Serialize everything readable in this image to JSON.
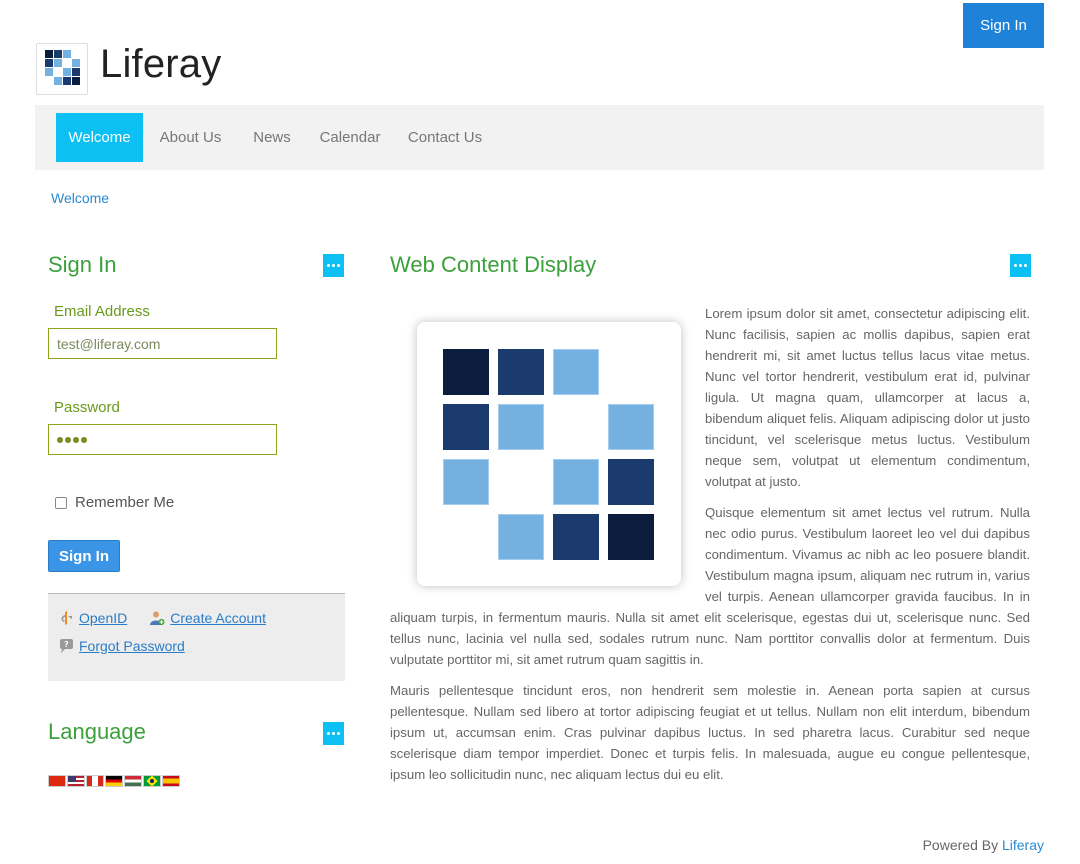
{
  "header": {
    "sign_in_label": "Sign In",
    "site_title": "Liferay"
  },
  "nav": {
    "items": [
      {
        "label": "Welcome",
        "active": true
      },
      {
        "label": "About Us",
        "active": false
      },
      {
        "label": "News",
        "active": false
      },
      {
        "label": "Calendar",
        "active": false
      },
      {
        "label": "Contact Us",
        "active": false
      }
    ]
  },
  "breadcrumb": "Welcome",
  "sign_in_portlet": {
    "title": "Sign In",
    "email_label": "Email Address",
    "email_value": "test@liferay.com",
    "password_label": "Password",
    "password_length": 4,
    "remember_label": "Remember Me",
    "submit_label": "Sign In",
    "links": {
      "openid": "OpenID",
      "create_account": "Create Account",
      "forgot_password": "Forgot Password"
    }
  },
  "language_portlet": {
    "title": "Language",
    "flags": [
      "zh-CN",
      "en-US",
      "en-CA",
      "de-DE",
      "hu-HU",
      "pt-BR",
      "es-ES"
    ]
  },
  "web_content": {
    "title": "Web Content Display",
    "paragraph_1": "Lorem ipsum dolor sit amet, consectetur adipiscing elit. Nunc facilisis, sapien ac mollis dapibus, sapien erat hendrerit mi, sit amet luctus tellus lacus vitae metus. Nunc vel tortor hendrerit, vestibulum erat id, pulvinar ligula. Ut magna quam, ullamcorper at lacus a, bibendum aliquet felis. Aliquam adipiscing dolor ut justo tincidunt, vel scelerisque metus luctus. Vestibulum neque sem, volutpat ut elementum condimentum, volutpat at justo.",
    "paragraph_2": "Quisque elementum sit amet lectus vel rutrum. Nulla nec odio purus. Vestibulum laoreet leo vel dui dapibus condimentum. Vivamus ac nibh ac leo posuere blandit. Vestibulum magna ipsum, aliquam nec rutrum in, varius vel turpis. Aenean ullamcorper gravida faucibus. In in aliquam turpis, in fermentum mauris. Nulla sit amet elit scelerisque, egestas dui ut, scelerisque nunc. Sed tellus nunc, lacinia vel nulla sed, sodales rutrum nunc. Nam porttitor convallis dolor at fermentum. Duis vulputate porttitor mi, sit amet rutrum quam sagittis in.",
    "paragraph_3": "Mauris pellentesque tincidunt eros, non hendrerit sem molestie in. Aenean porta sapien at cursus pellentesque. Nullam sed libero at tortor adipiscing feugiat et ut tellus. Nullam non elit interdum, bibendum ipsum ut, accumsan enim. Cras pulvinar dapibus luctus. In sed pharetra lacus. Curabitur sed neque scelerisque diam tempor imperdiet. Donec et turpis felis. In malesuada, augue eu congue pellentesque, ipsum leo sollicitudin nunc, nec aliquam lectus dui eu elit."
  },
  "footer": {
    "prefix": "Powered By",
    "link": "Liferay"
  },
  "colors": {
    "accent": "#0cc0f4",
    "portlet_title": "#3ca03c",
    "link": "#2a8ad2",
    "button": "#1e82d8"
  }
}
